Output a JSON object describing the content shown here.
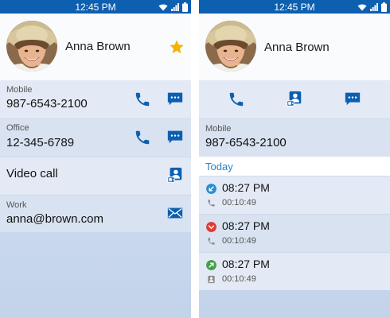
{
  "status": {
    "time": "12:45 PM"
  },
  "contact": {
    "name": "Anna Brown"
  },
  "left": {
    "mobile": {
      "label": "Mobile",
      "number": "987-6543-2100"
    },
    "office": {
      "label": "Office",
      "number": "12-345-6789"
    },
    "video": {
      "label": "Video call"
    },
    "work": {
      "label": "Work",
      "email": "anna@brown.com"
    }
  },
  "right": {
    "mobile": {
      "label": "Mobile",
      "number": "987-6543-2100"
    },
    "section": "Today",
    "logs": [
      {
        "time": "08:27 PM",
        "duration": "00:10:49",
        "direction": "incoming",
        "kind": "voice"
      },
      {
        "time": "08:27 PM",
        "duration": "00:10:49",
        "direction": "missed",
        "kind": "voice"
      },
      {
        "time": "08:27 PM",
        "duration": "00:10:49",
        "direction": "outgoing",
        "kind": "video"
      }
    ]
  },
  "colors": {
    "accent": "#0d5fb0",
    "star": "#f5b400",
    "incoming": "#2a8fcf",
    "missed": "#e53935",
    "outgoing": "#43a047"
  }
}
